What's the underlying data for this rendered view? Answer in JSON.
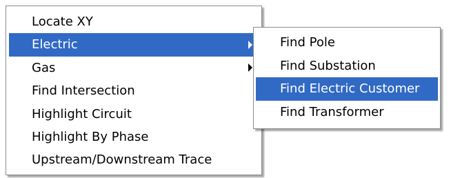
{
  "colors": {
    "highlight_bg": "#316ac5",
    "highlight_text": "#ffffff",
    "menu_bg": "#ffffff",
    "menu_border": "#8c8c8c"
  },
  "main_menu": {
    "items": [
      {
        "label": "Locate XY",
        "has_submenu": false,
        "highlighted": false
      },
      {
        "label": "Electric",
        "has_submenu": true,
        "highlighted": true
      },
      {
        "label": "Gas",
        "has_submenu": true,
        "highlighted": false
      },
      {
        "label": "Find Intersection",
        "has_submenu": false,
        "highlighted": false
      },
      {
        "label": "Highlight Circuit",
        "has_submenu": false,
        "highlighted": false
      },
      {
        "label": "Highlight By Phase",
        "has_submenu": false,
        "highlighted": false
      },
      {
        "label": "Upstream/Downstream Trace",
        "has_submenu": false,
        "highlighted": false
      }
    ]
  },
  "submenu": {
    "items": [
      {
        "label": "Find Pole",
        "highlighted": false
      },
      {
        "label": "Find Substation",
        "highlighted": false
      },
      {
        "label": "Find Electric Customer",
        "highlighted": true
      },
      {
        "label": "Find Transformer",
        "highlighted": false
      }
    ]
  }
}
